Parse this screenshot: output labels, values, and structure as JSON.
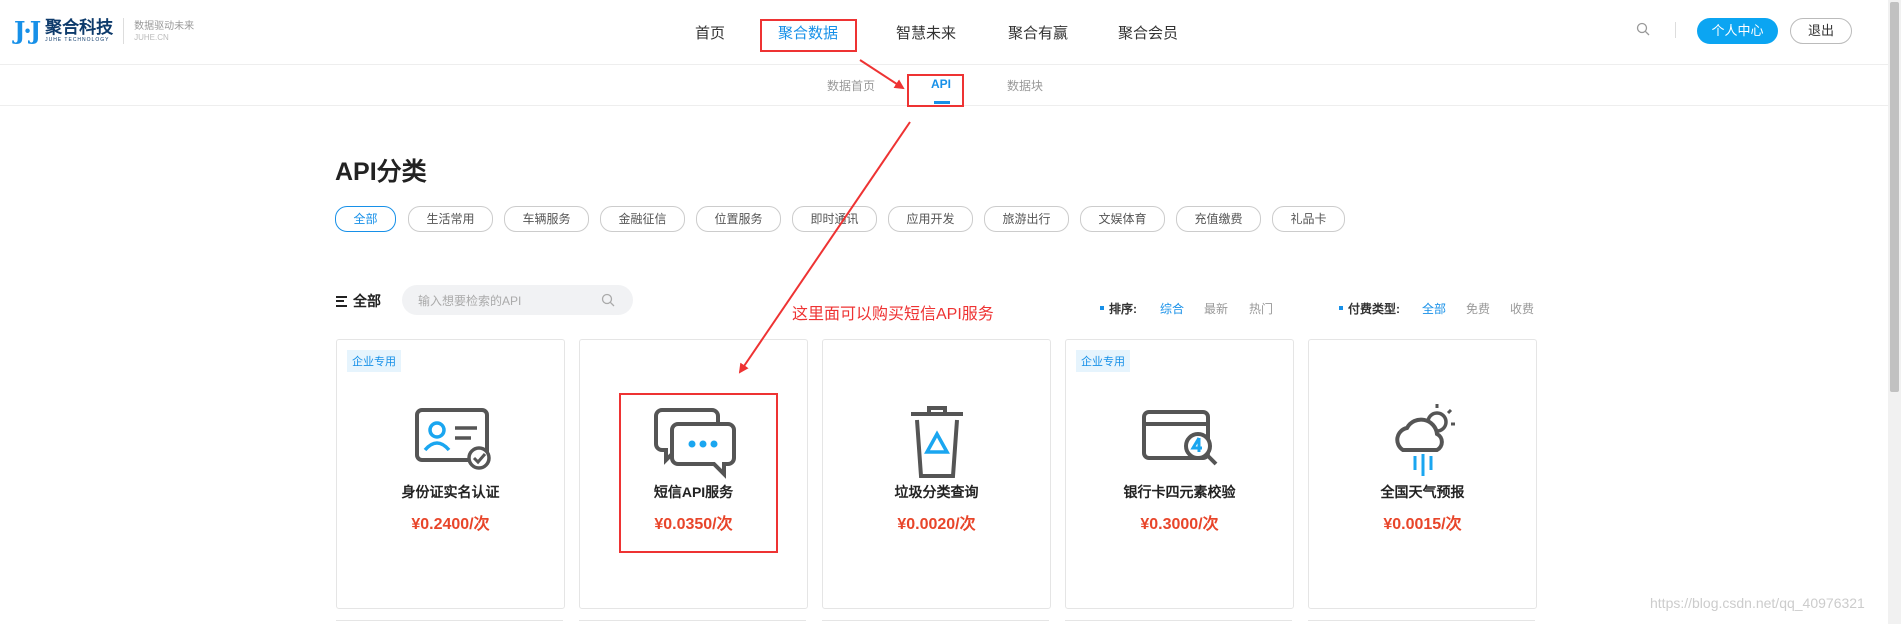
{
  "header": {
    "logo_mark": "J·J",
    "logo_cn": "聚合科技",
    "logo_en": "JUHE TECHNOLOGY",
    "slogan": "数据驱动未来",
    "slogan_en": "JUHE.CN",
    "nav": [
      "首页",
      "聚合数据",
      "智慧未来",
      "聚合有赢",
      "聚合会员"
    ],
    "active_nav": "聚合数据",
    "user_center": "个人中心",
    "logout": "退出"
  },
  "subnav": {
    "items": [
      "数据首页",
      "API",
      "数据块"
    ],
    "active": "API"
  },
  "page_title": "API分类",
  "categories": [
    "全部",
    "生活常用",
    "车辆服务",
    "金融征信",
    "位置服务",
    "即时通讯",
    "应用开发",
    "旅游出行",
    "文娱体育",
    "充值缴费",
    "礼品卡"
  ],
  "filter": {
    "label": "全部",
    "search_placeholder": "输入想要检索的API",
    "sort_label": "排序:",
    "sort_options": [
      "综合",
      "最新",
      "热门"
    ],
    "pay_label": "付费类型:",
    "pay_options": [
      "全部",
      "免费",
      "收费"
    ]
  },
  "annotation": "这里面可以购买短信API服务",
  "cards": [
    {
      "badge": "企业专用",
      "name": "身份证实名认证",
      "price": "¥0.2400/次",
      "icon": "id-card-icon"
    },
    {
      "badge": "",
      "name": "短信API服务",
      "price": "¥0.0350/次",
      "icon": "chat-bubbles-icon"
    },
    {
      "badge": "",
      "name": "垃圾分类查询",
      "price": "¥0.0020/次",
      "icon": "trash-bin-icon"
    },
    {
      "badge": "企业专用",
      "name": "银行卡四元素校验",
      "price": "¥0.3000/次",
      "icon": "bank-card-icon"
    },
    {
      "badge": "",
      "name": "全国天气预报",
      "price": "¥0.0015/次",
      "icon": "weather-icon"
    }
  ],
  "watermark": "https://blog.csdn.net/qq_40976321",
  "colors": {
    "accent": "#1790e8",
    "price": "#e8452a",
    "annotation": "#e33333"
  }
}
